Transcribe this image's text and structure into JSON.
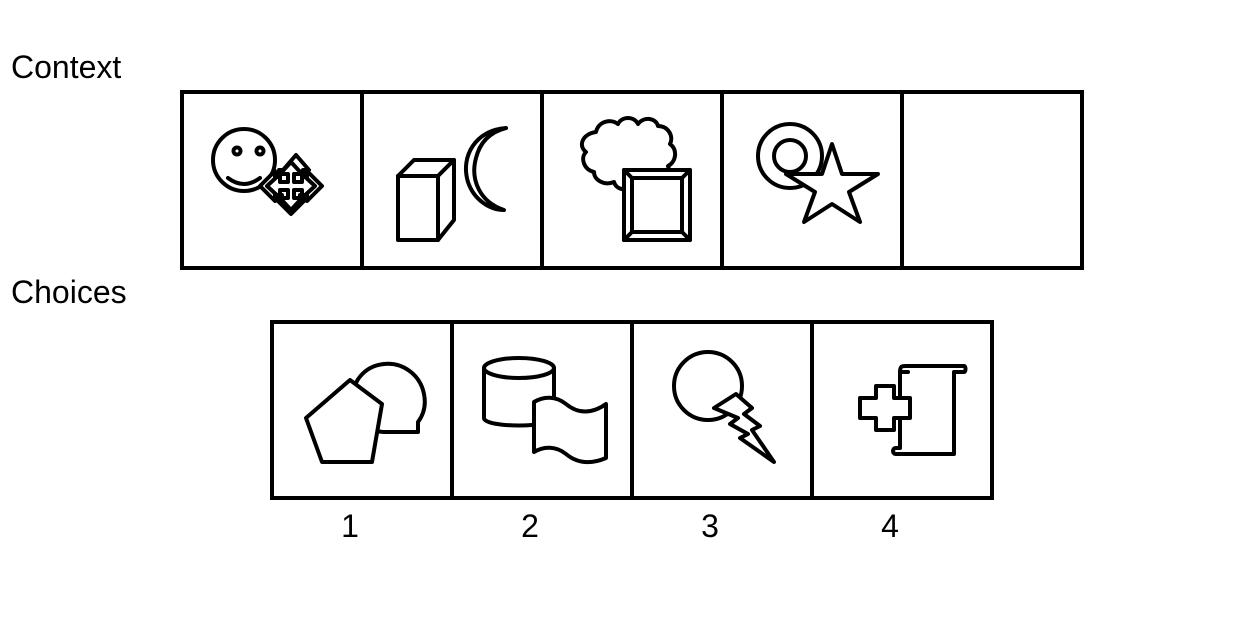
{
  "context": {
    "label": "Context",
    "panels": [
      {
        "shapes": [
          "smiley-face",
          "arrow-cross"
        ]
      },
      {
        "shapes": [
          "cube",
          "crescent-moon"
        ]
      },
      {
        "shapes": [
          "cloud",
          "beveled-square"
        ]
      },
      {
        "shapes": [
          "ring",
          "star"
        ]
      },
      {
        "shapes": []
      }
    ]
  },
  "choices": {
    "label": "Choices",
    "options": [
      {
        "number": "1",
        "shapes": [
          "pentagon",
          "speech-bubble"
        ]
      },
      {
        "number": "2",
        "shapes": [
          "cylinder",
          "wavy-flag"
        ]
      },
      {
        "number": "3",
        "shapes": [
          "circle",
          "lightning-bolt"
        ]
      },
      {
        "number": "4",
        "shapes": [
          "plus-cross",
          "scroll"
        ]
      }
    ]
  }
}
